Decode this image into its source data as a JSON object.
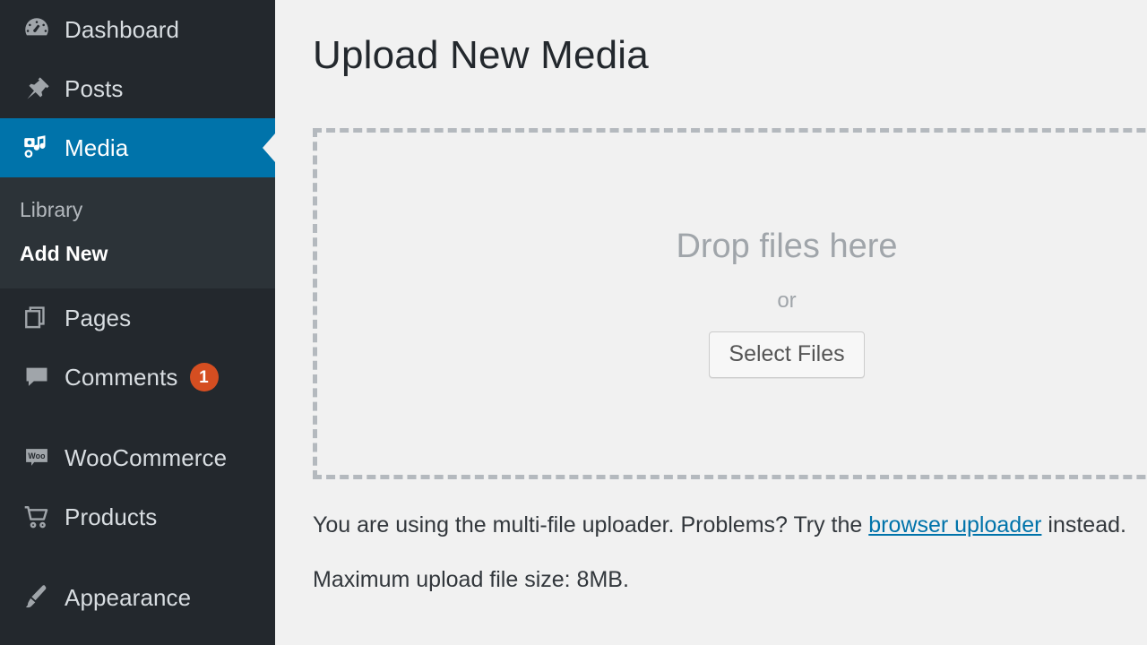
{
  "sidebar": {
    "items": [
      {
        "id": "dashboard",
        "label": "Dashboard",
        "icon": "dashboard-gauge-icon",
        "active": false,
        "badge": null
      },
      {
        "id": "posts",
        "label": "Posts",
        "icon": "pin-icon",
        "active": false,
        "badge": null
      },
      {
        "id": "media",
        "label": "Media",
        "icon": "media-camera-music-icon",
        "active": true,
        "badge": null
      },
      {
        "id": "pages",
        "label": "Pages",
        "icon": "pages-icon",
        "active": false,
        "badge": null
      },
      {
        "id": "comments",
        "label": "Comments",
        "icon": "comment-bubble-icon",
        "active": false,
        "badge": "1"
      },
      {
        "id": "woocommerce",
        "label": "WooCommerce",
        "icon": "woo-bubble-icon",
        "active": false,
        "badge": null
      },
      {
        "id": "products",
        "label": "Products",
        "icon": "shopping-cart-icon",
        "active": false,
        "badge": null
      },
      {
        "id": "appearance",
        "label": "Appearance",
        "icon": "paintbrush-icon",
        "active": false,
        "badge": null
      }
    ],
    "submenu": {
      "parent": "media",
      "items": [
        {
          "id": "library",
          "label": "Library",
          "current": false
        },
        {
          "id": "add-new",
          "label": "Add New",
          "current": true
        }
      ]
    }
  },
  "main": {
    "page_title": "Upload New Media",
    "dropzone": {
      "drop_text": "Drop files here",
      "or_text": "or",
      "select_files_label": "Select Files"
    },
    "notes": {
      "uploader_prefix": "You are using the multi-file uploader. Problems? Try the ",
      "uploader_link": "browser uploader",
      "uploader_suffix": " instead.",
      "max_upload": "Maximum upload file size: 8MB."
    }
  },
  "colors": {
    "sidebar_bg": "#23282d",
    "submenu_bg": "#2c3338",
    "active_blue": "#0073aa",
    "content_bg": "#f1f1f1",
    "dashed_border": "#b4b9be",
    "badge_red": "#d54e21",
    "link_blue": "#0073aa",
    "muted_text": "#a0a5aa"
  }
}
